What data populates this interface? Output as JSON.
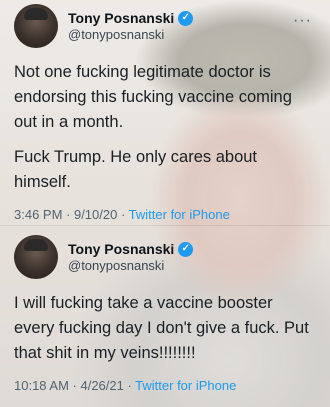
{
  "tweets": [
    {
      "author": {
        "name": "Tony Posnanski",
        "handle": "@tonyposnanski"
      },
      "paragraphs": [
        "Not one fucking legitimate doctor is endorsing this fucking vaccine coming out in a month.",
        "Fuck Trump. He only cares about himself."
      ],
      "timestamp": "3:46 PM · 9/10/20 · ",
      "source": "Twitter for iPhone",
      "icons": {
        "verified": "verified-badge-icon",
        "more": "more-options-icon"
      }
    },
    {
      "author": {
        "name": "Tony Posnanski",
        "handle": "@tonyposnanski"
      },
      "paragraphs": [
        "I will fucking take a vaccine booster every fucking day I don't give a fuck. Put that shit in my veins!!!!!!!!"
      ],
      "timestamp": "10:18 AM · 4/26/21 · ",
      "source": "Twitter for iPhone",
      "icons": {
        "verified": "verified-badge-icon"
      }
    }
  ],
  "colors": {
    "verified": "#1d9bf0",
    "link": "#1d9bf0",
    "muted": "#536471"
  }
}
